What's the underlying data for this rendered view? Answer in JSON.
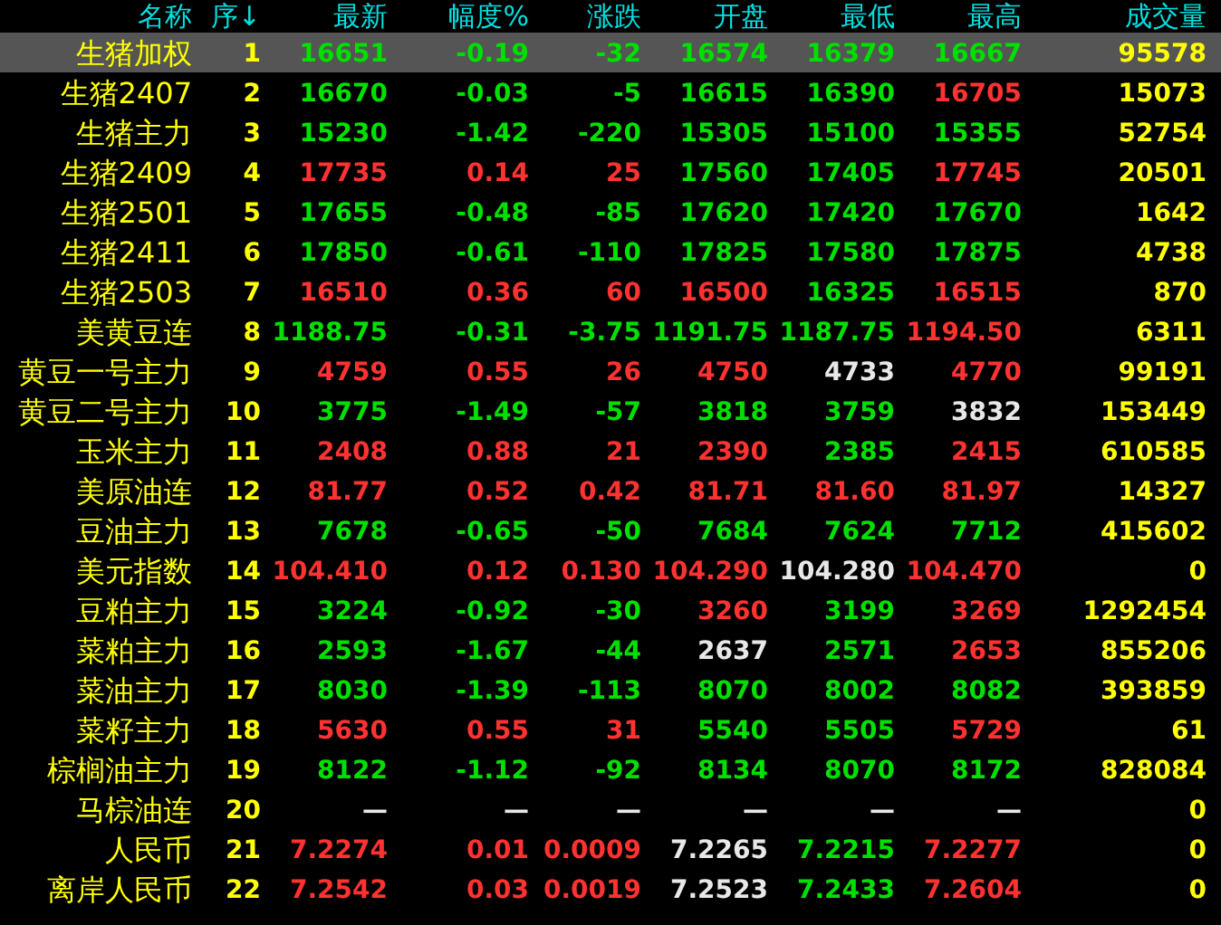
{
  "columns": [
    "名称",
    "序↓",
    "最新",
    "幅度%",
    "涨跌",
    "开盘",
    "最低",
    "最高",
    "成交量"
  ],
  "rows": [
    {
      "name": "生猪加权",
      "seq": "1",
      "selected": true,
      "cells": [
        {
          "text": "16651",
          "color": "#00e000"
        },
        {
          "text": "-0.19",
          "color": "#00e000"
        },
        {
          "text": "-32",
          "color": "#00e000"
        },
        {
          "text": "16574",
          "color": "#00e000"
        },
        {
          "text": "16379",
          "color": "#00e000"
        },
        {
          "text": "16667",
          "color": "#00e000"
        },
        {
          "text": "95578",
          "color": "#ffff00"
        }
      ]
    },
    {
      "name": "生猪2407",
      "seq": "2",
      "selected": false,
      "cells": [
        {
          "text": "16670",
          "color": "#00e000"
        },
        {
          "text": "-0.03",
          "color": "#00e000"
        },
        {
          "text": "-5",
          "color": "#00e000"
        },
        {
          "text": "16615",
          "color": "#00e000"
        },
        {
          "text": "16390",
          "color": "#00e000"
        },
        {
          "text": "16705",
          "color": "#ff3232"
        },
        {
          "text": "15073",
          "color": "#ffff00"
        }
      ]
    },
    {
      "name": "生猪主力",
      "seq": "3",
      "selected": false,
      "cells": [
        {
          "text": "15230",
          "color": "#00e000"
        },
        {
          "text": "-1.42",
          "color": "#00e000"
        },
        {
          "text": "-220",
          "color": "#00e000"
        },
        {
          "text": "15305",
          "color": "#00e000"
        },
        {
          "text": "15100",
          "color": "#00e000"
        },
        {
          "text": "15355",
          "color": "#00e000"
        },
        {
          "text": "52754",
          "color": "#ffff00"
        }
      ]
    },
    {
      "name": "生猪2409",
      "seq": "4",
      "selected": false,
      "cells": [
        {
          "text": "17735",
          "color": "#ff3232"
        },
        {
          "text": "0.14",
          "color": "#ff3232"
        },
        {
          "text": "25",
          "color": "#ff3232"
        },
        {
          "text": "17560",
          "color": "#00e000"
        },
        {
          "text": "17405",
          "color": "#00e000"
        },
        {
          "text": "17745",
          "color": "#ff3232"
        },
        {
          "text": "20501",
          "color": "#ffff00"
        }
      ]
    },
    {
      "name": "生猪2501",
      "seq": "5",
      "selected": false,
      "cells": [
        {
          "text": "17655",
          "color": "#00e000"
        },
        {
          "text": "-0.48",
          "color": "#00e000"
        },
        {
          "text": "-85",
          "color": "#00e000"
        },
        {
          "text": "17620",
          "color": "#00e000"
        },
        {
          "text": "17420",
          "color": "#00e000"
        },
        {
          "text": "17670",
          "color": "#00e000"
        },
        {
          "text": "1642",
          "color": "#ffff00"
        }
      ]
    },
    {
      "name": "生猪2411",
      "seq": "6",
      "selected": false,
      "cells": [
        {
          "text": "17850",
          "color": "#00e000"
        },
        {
          "text": "-0.61",
          "color": "#00e000"
        },
        {
          "text": "-110",
          "color": "#00e000"
        },
        {
          "text": "17825",
          "color": "#00e000"
        },
        {
          "text": "17580",
          "color": "#00e000"
        },
        {
          "text": "17875",
          "color": "#00e000"
        },
        {
          "text": "4738",
          "color": "#ffff00"
        }
      ]
    },
    {
      "name": "生猪2503",
      "seq": "7",
      "selected": false,
      "cells": [
        {
          "text": "16510",
          "color": "#ff3232"
        },
        {
          "text": "0.36",
          "color": "#ff3232"
        },
        {
          "text": "60",
          "color": "#ff3232"
        },
        {
          "text": "16500",
          "color": "#ff3232"
        },
        {
          "text": "16325",
          "color": "#00e000"
        },
        {
          "text": "16515",
          "color": "#ff3232"
        },
        {
          "text": "870",
          "color": "#ffff00"
        }
      ]
    },
    {
      "name": "美黄豆连",
      "seq": "8",
      "selected": false,
      "cells": [
        {
          "text": "1188.75",
          "color": "#00e000"
        },
        {
          "text": "-0.31",
          "color": "#00e000"
        },
        {
          "text": "-3.75",
          "color": "#00e000"
        },
        {
          "text": "1191.75",
          "color": "#00e000"
        },
        {
          "text": "1187.75",
          "color": "#00e000"
        },
        {
          "text": "1194.50",
          "color": "#ff3232"
        },
        {
          "text": "6311",
          "color": "#ffff00"
        }
      ]
    },
    {
      "name": "黄豆一号主力",
      "seq": "9",
      "selected": false,
      "cells": [
        {
          "text": "4759",
          "color": "#ff3232"
        },
        {
          "text": "0.55",
          "color": "#ff3232"
        },
        {
          "text": "26",
          "color": "#ff3232"
        },
        {
          "text": "4750",
          "color": "#ff3232"
        },
        {
          "text": "4733",
          "color": "#e8e8e8"
        },
        {
          "text": "4770",
          "color": "#ff3232"
        },
        {
          "text": "99191",
          "color": "#ffff00"
        }
      ]
    },
    {
      "name": "黄豆二号主力",
      "seq": "10",
      "selected": false,
      "cells": [
        {
          "text": "3775",
          "color": "#00e000"
        },
        {
          "text": "-1.49",
          "color": "#00e000"
        },
        {
          "text": "-57",
          "color": "#00e000"
        },
        {
          "text": "3818",
          "color": "#00e000"
        },
        {
          "text": "3759",
          "color": "#00e000"
        },
        {
          "text": "3832",
          "color": "#e8e8e8"
        },
        {
          "text": "153449",
          "color": "#ffff00"
        }
      ]
    },
    {
      "name": "玉米主力",
      "seq": "11",
      "selected": false,
      "cells": [
        {
          "text": "2408",
          "color": "#ff3232"
        },
        {
          "text": "0.88",
          "color": "#ff3232"
        },
        {
          "text": "21",
          "color": "#ff3232"
        },
        {
          "text": "2390",
          "color": "#ff3232"
        },
        {
          "text": "2385",
          "color": "#00e000"
        },
        {
          "text": "2415",
          "color": "#ff3232"
        },
        {
          "text": "610585",
          "color": "#ffff00"
        }
      ]
    },
    {
      "name": "美原油连",
      "seq": "12",
      "selected": false,
      "cells": [
        {
          "text": "81.77",
          "color": "#ff3232"
        },
        {
          "text": "0.52",
          "color": "#ff3232"
        },
        {
          "text": "0.42",
          "color": "#ff3232"
        },
        {
          "text": "81.71",
          "color": "#ff3232"
        },
        {
          "text": "81.60",
          "color": "#ff3232"
        },
        {
          "text": "81.97",
          "color": "#ff3232"
        },
        {
          "text": "14327",
          "color": "#ffff00"
        }
      ]
    },
    {
      "name": "豆油主力",
      "seq": "13",
      "selected": false,
      "cells": [
        {
          "text": "7678",
          "color": "#00e000"
        },
        {
          "text": "-0.65",
          "color": "#00e000"
        },
        {
          "text": "-50",
          "color": "#00e000"
        },
        {
          "text": "7684",
          "color": "#00e000"
        },
        {
          "text": "7624",
          "color": "#00e000"
        },
        {
          "text": "7712",
          "color": "#00e000"
        },
        {
          "text": "415602",
          "color": "#ffff00"
        }
      ]
    },
    {
      "name": "美元指数",
      "seq": "14",
      "selected": false,
      "cells": [
        {
          "text": "104.410",
          "color": "#ff3232"
        },
        {
          "text": "0.12",
          "color": "#ff3232"
        },
        {
          "text": "0.130",
          "color": "#ff3232"
        },
        {
          "text": "104.290",
          "color": "#ff3232"
        },
        {
          "text": "104.280",
          "color": "#e8e8e8"
        },
        {
          "text": "104.470",
          "color": "#ff3232"
        },
        {
          "text": "0",
          "color": "#ffff00"
        }
      ]
    },
    {
      "name": "豆粕主力",
      "seq": "15",
      "selected": false,
      "cells": [
        {
          "text": "3224",
          "color": "#00e000"
        },
        {
          "text": "-0.92",
          "color": "#00e000"
        },
        {
          "text": "-30",
          "color": "#00e000"
        },
        {
          "text": "3260",
          "color": "#ff3232"
        },
        {
          "text": "3199",
          "color": "#00e000"
        },
        {
          "text": "3269",
          "color": "#ff3232"
        },
        {
          "text": "1292454",
          "color": "#ffff00"
        }
      ]
    },
    {
      "name": "菜粕主力",
      "seq": "16",
      "selected": false,
      "cells": [
        {
          "text": "2593",
          "color": "#00e000"
        },
        {
          "text": "-1.67",
          "color": "#00e000"
        },
        {
          "text": "-44",
          "color": "#00e000"
        },
        {
          "text": "2637",
          "color": "#e8e8e8"
        },
        {
          "text": "2571",
          "color": "#00e000"
        },
        {
          "text": "2653",
          "color": "#ff3232"
        },
        {
          "text": "855206",
          "color": "#ffff00"
        }
      ]
    },
    {
      "name": "菜油主力",
      "seq": "17",
      "selected": false,
      "cells": [
        {
          "text": "8030",
          "color": "#00e000"
        },
        {
          "text": "-1.39",
          "color": "#00e000"
        },
        {
          "text": "-113",
          "color": "#00e000"
        },
        {
          "text": "8070",
          "color": "#00e000"
        },
        {
          "text": "8002",
          "color": "#00e000"
        },
        {
          "text": "8082",
          "color": "#00e000"
        },
        {
          "text": "393859",
          "color": "#ffff00"
        }
      ]
    },
    {
      "name": "菜籽主力",
      "seq": "18",
      "selected": false,
      "cells": [
        {
          "text": "5630",
          "color": "#ff3232"
        },
        {
          "text": "0.55",
          "color": "#ff3232"
        },
        {
          "text": "31",
          "color": "#ff3232"
        },
        {
          "text": "5540",
          "color": "#00e000"
        },
        {
          "text": "5505",
          "color": "#00e000"
        },
        {
          "text": "5729",
          "color": "#ff3232"
        },
        {
          "text": "61",
          "color": "#ffff00"
        }
      ]
    },
    {
      "name": "棕榈油主力",
      "seq": "19",
      "selected": false,
      "cells": [
        {
          "text": "8122",
          "color": "#00e000"
        },
        {
          "text": "-1.12",
          "color": "#00e000"
        },
        {
          "text": "-92",
          "color": "#00e000"
        },
        {
          "text": "8134",
          "color": "#00e000"
        },
        {
          "text": "8070",
          "color": "#00e000"
        },
        {
          "text": "8172",
          "color": "#00e000"
        },
        {
          "text": "828084",
          "color": "#ffff00"
        }
      ]
    },
    {
      "name": "马棕油连",
      "seq": "20",
      "selected": false,
      "cells": [
        {
          "text": "—",
          "color": "#e8e8e8"
        },
        {
          "text": "—",
          "color": "#e8e8e8"
        },
        {
          "text": "—",
          "color": "#e8e8e8"
        },
        {
          "text": "—",
          "color": "#e8e8e8"
        },
        {
          "text": "—",
          "color": "#e8e8e8"
        },
        {
          "text": "—",
          "color": "#e8e8e8"
        },
        {
          "text": "0",
          "color": "#ffff00"
        }
      ]
    },
    {
      "name": "人民币",
      "seq": "21",
      "selected": false,
      "cells": [
        {
          "text": "7.2274",
          "color": "#ff3232"
        },
        {
          "text": "0.01",
          "color": "#ff3232"
        },
        {
          "text": "0.0009",
          "color": "#ff3232"
        },
        {
          "text": "7.2265",
          "color": "#e8e8e8"
        },
        {
          "text": "7.2215",
          "color": "#00e000"
        },
        {
          "text": "7.2277",
          "color": "#ff3232"
        },
        {
          "text": "0",
          "color": "#ffff00"
        }
      ]
    },
    {
      "name": "离岸人民币",
      "seq": "22",
      "selected": false,
      "cells": [
        {
          "text": "7.2542",
          "color": "#ff3232"
        },
        {
          "text": "0.03",
          "color": "#ff3232"
        },
        {
          "text": "0.0019",
          "color": "#ff3232"
        },
        {
          "text": "7.2523",
          "color": "#e8e8e8"
        },
        {
          "text": "7.2433",
          "color": "#00e000"
        },
        {
          "text": "7.2604",
          "color": "#ff3232"
        },
        {
          "text": "0",
          "color": "#ffff00"
        }
      ]
    }
  ]
}
